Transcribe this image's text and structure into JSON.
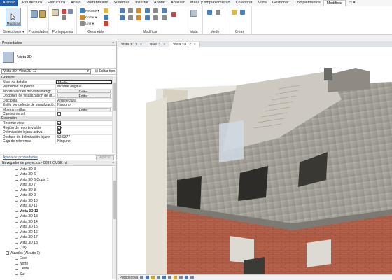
{
  "menu": {
    "file": "Archivo",
    "tabs": [
      "Arquitectura",
      "Estructura",
      "Acero",
      "Prefabricado",
      "Sistemas",
      "Insertar",
      "Anotar",
      "Analizar",
      "Masa y emplazamiento",
      "Colaborar",
      "Vista",
      "Gestionar",
      "Complementos",
      "Modificar"
    ],
    "active_tab": "Modificar",
    "extra": "▭ ▾"
  },
  "ribbon": {
    "modify_big": "Modificar",
    "select_label": "Seleccionar ▾",
    "properties_label": "Propiedades",
    "clipboard_label": "Portapapeles",
    "geometry_label": "Geometría",
    "modify_label": "Modificar",
    "view_label": "Vista",
    "measure_label": "Medir",
    "create_label": "Crear",
    "cut_label": "Recorte ▾",
    "join_label": "Cortar ▾",
    "join2_label": "Unir ▾"
  },
  "properties": {
    "title": "Propiedades",
    "close": "×",
    "type_name": "Vista 3D",
    "instance_selector": "Vista 3D: Vista 3D 12",
    "edit_type": "Editar tipo",
    "categories": [
      {
        "name": "Gráficos",
        "rows": [
          {
            "k": "Nivel de detalle",
            "v": "Medio",
            "style": "editable"
          },
          {
            "k": "Visibilidad de piezas",
            "v": "Mostrar original",
            "style": "text"
          },
          {
            "k": "Modificaciones de visibilidad/gr...",
            "v": "Editar...",
            "style": "btn"
          },
          {
            "k": "Opciones de visualización de gr...",
            "v": "Editar...",
            "style": "btn"
          },
          {
            "k": "Disciplina",
            "v": "Arquitectura",
            "style": "text"
          },
          {
            "k": "Estilo por defecto de visualizació...",
            "v": "Ninguno",
            "style": "text"
          },
          {
            "k": "Mostrar rejillas",
            "v": "Editar...",
            "style": "btn"
          },
          {
            "k": "Camino de sol",
            "v": "",
            "style": "check-off"
          }
        ]
      },
      {
        "name": "Extensión",
        "rows": [
          {
            "k": "Recortar vista",
            "v": "",
            "style": "check-on"
          },
          {
            "k": "Región de recorte visible",
            "v": "",
            "style": "check-on"
          },
          {
            "k": "Delimitación lejana activa",
            "v": "",
            "style": "check-on"
          },
          {
            "k": "Desfase de delimitación lejano",
            "v": "52.9377",
            "style": "text"
          },
          {
            "k": "Caja de referencia",
            "v": "Ninguno",
            "style": "text"
          }
        ]
      }
    ],
    "help_link": "Ayuda de propiedades",
    "apply": "Aplicar"
  },
  "browser": {
    "title": "Navegador de proyectos - 003 HOUSE.rvt",
    "close": "×",
    "items": [
      {
        "label": "Vista 3D 3",
        "sel": false
      },
      {
        "label": "Vista 3D 6",
        "sel": false
      },
      {
        "label": "Vista 3D 6 Copia 1",
        "sel": false
      },
      {
        "label": "Vista 3D 7",
        "sel": false
      },
      {
        "label": "Vista 3D 8",
        "sel": false
      },
      {
        "label": "Vista 3D 9",
        "sel": false
      },
      {
        "label": "Vista 3D 10",
        "sel": false
      },
      {
        "label": "Vista 3D 11",
        "sel": false
      },
      {
        "label": "Vista 3D 12",
        "sel": true
      },
      {
        "label": "Vista 3D 13",
        "sel": false
      },
      {
        "label": "Vista 3D 14",
        "sel": false
      },
      {
        "label": "Vista 3D 15",
        "sel": false
      },
      {
        "label": "Vista 3D 16",
        "sel": false
      },
      {
        "label": "Vista 3D 17",
        "sel": false
      },
      {
        "label": "Vista 3D 18",
        "sel": false
      },
      {
        "label": "{3D}",
        "sel": false
      }
    ],
    "elevations": "Alzados (Alzado 1)",
    "elevation_items": [
      "Este",
      "Norte",
      "Oeste",
      "Sur"
    ]
  },
  "view_tabs": [
    {
      "label": "Vista 3D 3",
      "active": false
    },
    {
      "label": "Nivel 3",
      "active": false
    },
    {
      "label": "Vista 3D 12",
      "active": true
    }
  ],
  "status": {
    "mode": "Perspectiva"
  }
}
